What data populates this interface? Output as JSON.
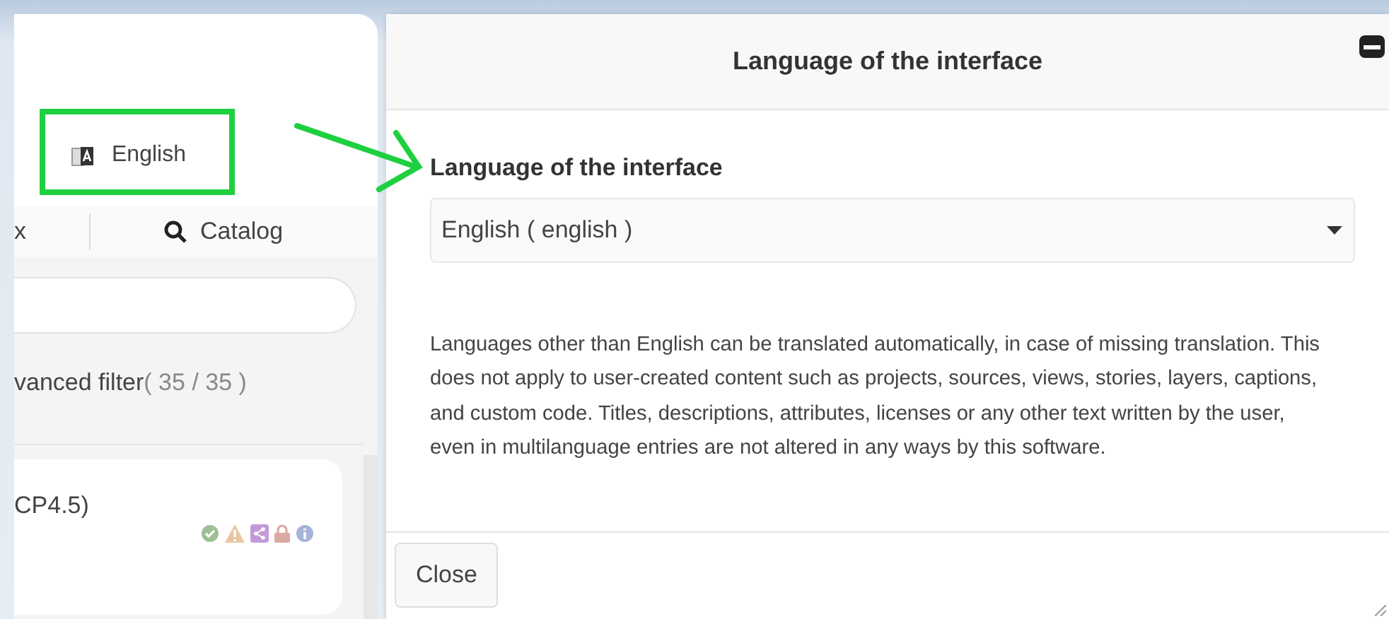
{
  "sidebar": {
    "language_button": "English",
    "tabs": [
      {
        "label": "x",
        "selected": false
      },
      {
        "label": "Catalog",
        "selected": false
      }
    ],
    "filter_label": "vanced filter",
    "filter_count": "( 35 / 35 )",
    "cards": [
      {
        "title": "CP4.5)"
      }
    ]
  },
  "dialog": {
    "title": "Language of the interface",
    "field_label": "Language of the interface",
    "select_value": "English ( english )",
    "description": "Languages other than English can be translated automatically, in case of missing translation. This does not apply to user-created content such as projects, sources, views, stories, layers, captions, and custom code. Titles, descriptions, attributes, licenses or any other text written by the user, even in multilanguage entries are not altered in any ways by this software.",
    "buttons": [
      "Close"
    ]
  }
}
